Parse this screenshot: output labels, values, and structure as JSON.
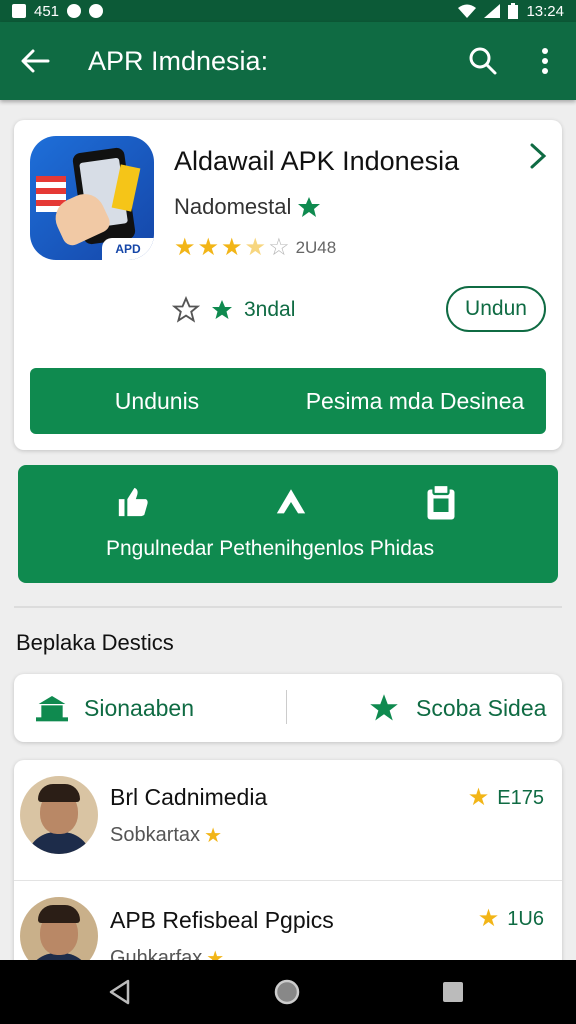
{
  "status": {
    "time_left": "451",
    "time_right": "13:24"
  },
  "appbar": {
    "title": "APR Imdnesia:",
    "back_icon": "arrow-left-icon",
    "search_icon": "search-icon",
    "menu_icon": "more-vert-icon"
  },
  "app": {
    "name": "Aldawail APK Indonesia",
    "icon_tag": "APD",
    "developer": "Nadomestal",
    "rating": 3.5,
    "rating_count": "2U48",
    "fav_label": "3ndal",
    "install_label": "Undun",
    "action_left": "Undunis",
    "action_right": "Pesima mda Desinea"
  },
  "features": {
    "text": "Pngulnedar Pethenihgenlos Phidas"
  },
  "section": {
    "title": "Beplaka Destics"
  },
  "toggles": {
    "left": "Sionaaben",
    "right": "Scoba Sidea"
  },
  "list": [
    {
      "title": "Brl Cadnimedia",
      "subtitle": "Sobkartax",
      "score": "E175"
    },
    {
      "title": "APB Refisbeal Pgpics",
      "subtitle": "Guhkarfax",
      "score": "1U6"
    }
  ],
  "colors": {
    "primary_dark": "#0c5a37",
    "primary": "#0f6b43",
    "accent": "#0f8a4f",
    "star": "#f2b517"
  }
}
